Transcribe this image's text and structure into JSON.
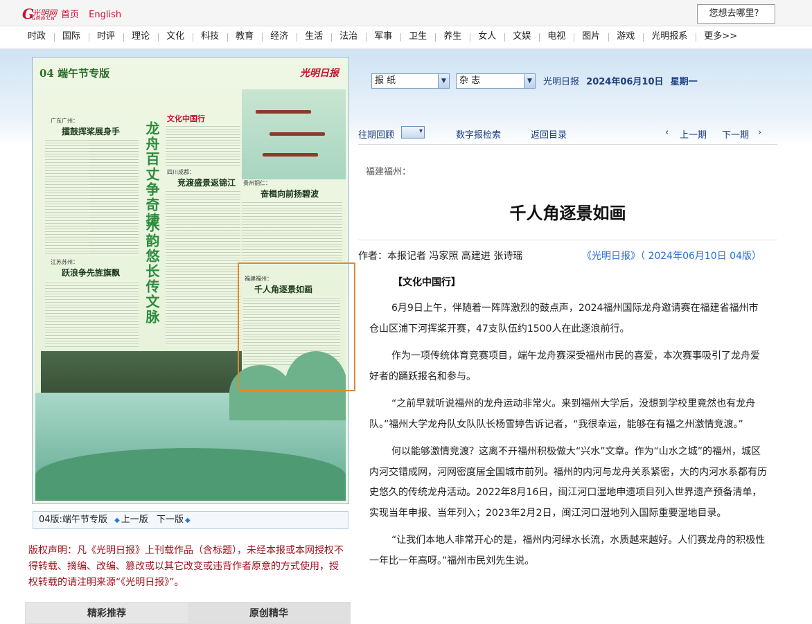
{
  "header": {
    "logo_mark": "G",
    "logo_text": "光明网",
    "logo_sub": "GMW.CN",
    "links": [
      "首页",
      "English"
    ],
    "where_button": "您想去哪里？"
  },
  "nav": [
    "时政",
    "国际",
    "时评",
    "理论",
    "文化",
    "科技",
    "教育",
    "经济",
    "生活",
    "法治",
    "军事",
    "卫生",
    "养生",
    "女人",
    "文娱",
    "电视",
    "图片",
    "游戏",
    "光明报系",
    "更多>>"
  ],
  "paper": {
    "page_label": "04 端午节专版",
    "brand": "光明日报",
    "vertical_title_1": "龙舟百丈争奇捷",
    "vertical_title_2": "水韵悠长传文脉",
    "column_logo": "文化中国行",
    "articles": [
      {
        "city": "广东广州：",
        "title": "擂鼓挥桨展身手"
      },
      {
        "city": "江苏苏州：",
        "title": "跃浪争先旌旗飘"
      },
      {
        "city": "四川成都：",
        "title": "竞渡盛景返锦江"
      },
      {
        "city": "贵州铜仁：",
        "title": "奋楫向前扬碧波"
      },
      {
        "city": "福建福州：",
        "title": "千人角逐景如画"
      }
    ]
  },
  "pager": {
    "current": "04版:端午节专版",
    "prev": "上一版",
    "next": "下一版"
  },
  "copyright": "版权声明：凡《光明日报》上刊载作品（含标题），未经本报或本网授权不得转载、摘编、改编、篡改或以其它改变或违背作者原意的方式使用，授权转载的请注明来源“《光明日报》”。",
  "tabs": [
    "精彩推荐",
    "原创精华"
  ],
  "controls": {
    "select_paper": "报  纸",
    "select_magazine": "杂  志",
    "paper_name": "光明日报",
    "date": "2024年06月10日",
    "weekday": "星期一",
    "back_issue": "往期回顾",
    "digital_search": "数字报检索",
    "back_to_index": "返回目录",
    "prev_issue": "上一期",
    "next_issue": "下一期"
  },
  "article": {
    "city": "福建福州：",
    "title": "千人角逐景如画",
    "byline": "作者：本报记者  冯家照  高建进  张诗瑶",
    "source": "《光明日报》（ 2024年06月10日   04版）",
    "column": "【文化中国行】",
    "paragraphs": [
      "6月9日上午，伴随着一阵阵激烈的鼓点声，2024福州国际龙舟邀请赛在福建省福州市仓山区浦下河挥桨开赛，47支队伍约1500人在此逐浪前行。",
      "作为一项传统体育竞赛项目，端午龙舟赛深受福州市民的喜爱，本次赛事吸引了龙舟爱好者的踊跃报名和参与。",
      "“之前早就听说福州的龙舟运动非常火。来到福州大学后，没想到学校里竟然也有龙舟队。”福州大学龙舟队女队队长杨雪婷告诉记者，“我很幸运，能够在有福之州激情竞渡。”",
      "何以能够激情竞渡？这离不开福州积极做大“兴水”文章。作为“山水之城”的福州，城区内河交错成网，河网密度居全国城市前列。福州的内河与龙舟关系紧密，大的内河水系都有历史悠久的传统龙舟活动。2022年8月16日，闽江河口湿地申遗项目列入世界遗产预备清单，实现当年申报、当年列入；2023年2月2日，闽江河口湿地列入国际重要湿地目录。",
      "“让我们本地人非常开心的是，福州内河绿水长流，水质越来越好。人们赛龙舟的积极性一年比一年高呀。”福州市民刘先生说。"
    ]
  }
}
